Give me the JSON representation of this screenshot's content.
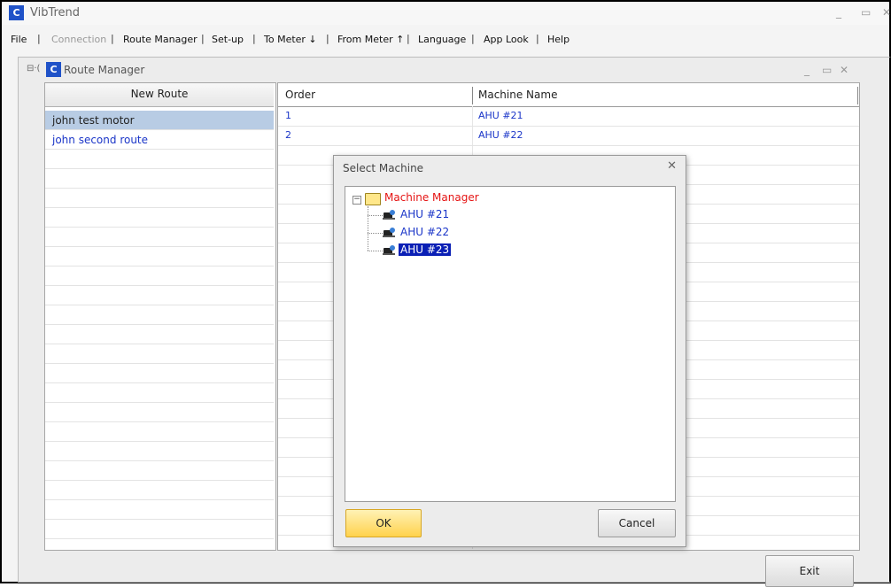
{
  "window": {
    "app_icon": "C",
    "title": "VibTrend",
    "minimize": "_",
    "restore": "▭",
    "close": "✕"
  },
  "menu": {
    "items": [
      "File",
      "Connection",
      "Route Manager",
      "Set-up",
      "To Meter ↓",
      "From Meter ↑",
      "Language",
      "App Look",
      "Help"
    ],
    "separator": "|"
  },
  "child_window": {
    "icon": "C",
    "title": "Route Manager",
    "minimize": "_",
    "restore": "▭",
    "close": "✕",
    "tree_stub": "⊟·("
  },
  "routes": {
    "new_route_label": "New Route",
    "items": [
      "john test motor",
      "john second route"
    ],
    "selected_index": 0
  },
  "grid": {
    "columns": [
      "Order",
      "Machine Name"
    ],
    "rows": [
      {
        "order": "1",
        "machine": "AHU #21"
      },
      {
        "order": "2",
        "machine": "AHU #22"
      }
    ]
  },
  "exit_label": "Exit",
  "dialog": {
    "title": "Select Machine",
    "close": "✕",
    "tree": {
      "expander": "−",
      "root": "Machine Manager",
      "children": [
        "AHU #21",
        "AHU #22",
        "AHU #23"
      ],
      "selected": "AHU #23"
    },
    "ok_label": "OK",
    "cancel_label": "Cancel"
  },
  "colors": {
    "accent_selected": "#0a1fb5",
    "link_text": "#1a35c8",
    "root_text": "#e51414",
    "ok_button": "#ffd24d",
    "route_selected": "#b8cce4"
  }
}
